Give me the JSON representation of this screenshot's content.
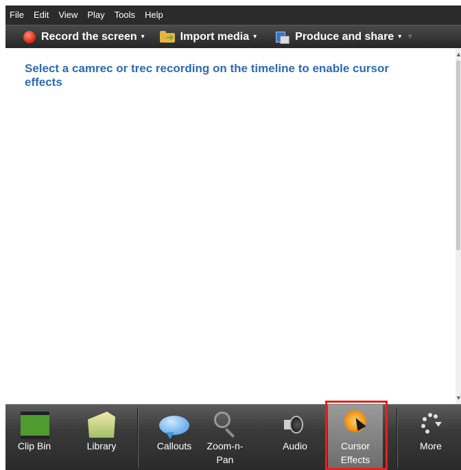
{
  "menu": {
    "items": [
      {
        "label": "File"
      },
      {
        "label": "Edit"
      },
      {
        "label": "View"
      },
      {
        "label": "Play"
      },
      {
        "label": "Tools"
      },
      {
        "label": "Help"
      }
    ]
  },
  "toolbar": {
    "record_label": "Record the screen",
    "import_label": "Import media",
    "produce_label": "Produce and share",
    "caret": "▾",
    "overflow": "▿"
  },
  "content": {
    "message": "Select a camrec or trec recording on the timeline to enable cursor effects"
  },
  "tasks": {
    "clip_bin": {
      "label": "Clip Bin"
    },
    "library": {
      "label": "Library"
    },
    "callouts": {
      "label": "Callouts"
    },
    "zoom": {
      "label": "Zoom-n-Pan"
    },
    "audio": {
      "label": "Audio"
    },
    "cursor": {
      "label": "Cursor Effects"
    },
    "more": {
      "label": "More"
    }
  },
  "colors": {
    "message_text": "#2e6aaf",
    "highlight_border": "#e8201a",
    "active_tab": "#8a8a8a"
  },
  "icons": {
    "record": "record-dot-icon",
    "import": "folder-import-icon",
    "produce": "produce-share-icon",
    "clip_bin": "filmstrip-icon",
    "library": "library-folder-icon",
    "callouts": "speech-bubble-icon",
    "zoom": "magnifier-icon",
    "audio": "speaker-icon",
    "cursor": "cursor-effects-icon",
    "more": "more-dots-icon"
  }
}
